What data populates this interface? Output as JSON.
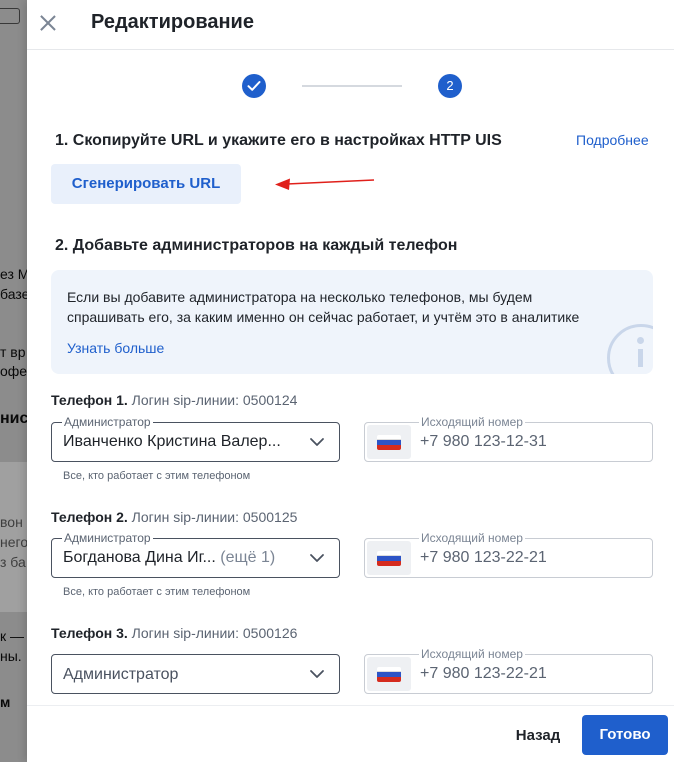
{
  "background": {
    "fragments": [
      "ез M",
      "базе",
      "т вр",
      "офе",
      "ниси",
      "вон",
      "него",
      "з ба",
      "к —",
      "ны.",
      "м"
    ]
  },
  "header": {
    "title": "Редактирование",
    "close_icon": "close-icon"
  },
  "stepper": {
    "step1_icon": "check-icon",
    "step2_label": "2"
  },
  "section1": {
    "title": "1. Скопируйте URL и укажите его в настройках HTTP UIS",
    "more_link": "Подробнее",
    "generate_button": "Сгенерировать URL"
  },
  "section2": {
    "title": "2. Добавьте администраторов на каждый телефон",
    "info_text": "Если вы добавите администратора на несколько телефонов, мы будем спрашивать его, за каким именно он сейчас работает, и учтём это в аналитике",
    "info_link": "Узнать больше",
    "info_icon": "info-icon"
  },
  "phones": [
    {
      "title": "Телефон 1.",
      "login": "Логин sip-линии: 0500124",
      "admin_label": "Администратор",
      "admin_value": "Иванченко Кристина Валер...",
      "admin_extra": "",
      "hint": "Все, кто работает с этим телефоном",
      "outgoing_label": "Исходящий номер",
      "outgoing_value": "+7 980 123-12-31"
    },
    {
      "title": "Телефон 2.",
      "login": "Логин sip-линии: 0500125",
      "admin_label": "Администратор",
      "admin_value": "Богданова Дина Иг...",
      "admin_extra": "(ещё 1)",
      "hint": "Все, кто работает с этим телефоном",
      "outgoing_label": "Исходящий номер",
      "outgoing_value": "+7 980 123-22-21"
    },
    {
      "title": "Телефон 3.",
      "login": "Логин sip-линии: 0500126",
      "admin_placeholder": "Администратор",
      "outgoing_label": "Исходящий номер",
      "outgoing_value": "+7 980 123-22-21"
    }
  ],
  "footer": {
    "back": "Назад",
    "done": "Готово"
  },
  "colors": {
    "accent": "#1f5fcc",
    "annotation_arrow": "#e0201b",
    "info_bg": "#eff4fb"
  }
}
